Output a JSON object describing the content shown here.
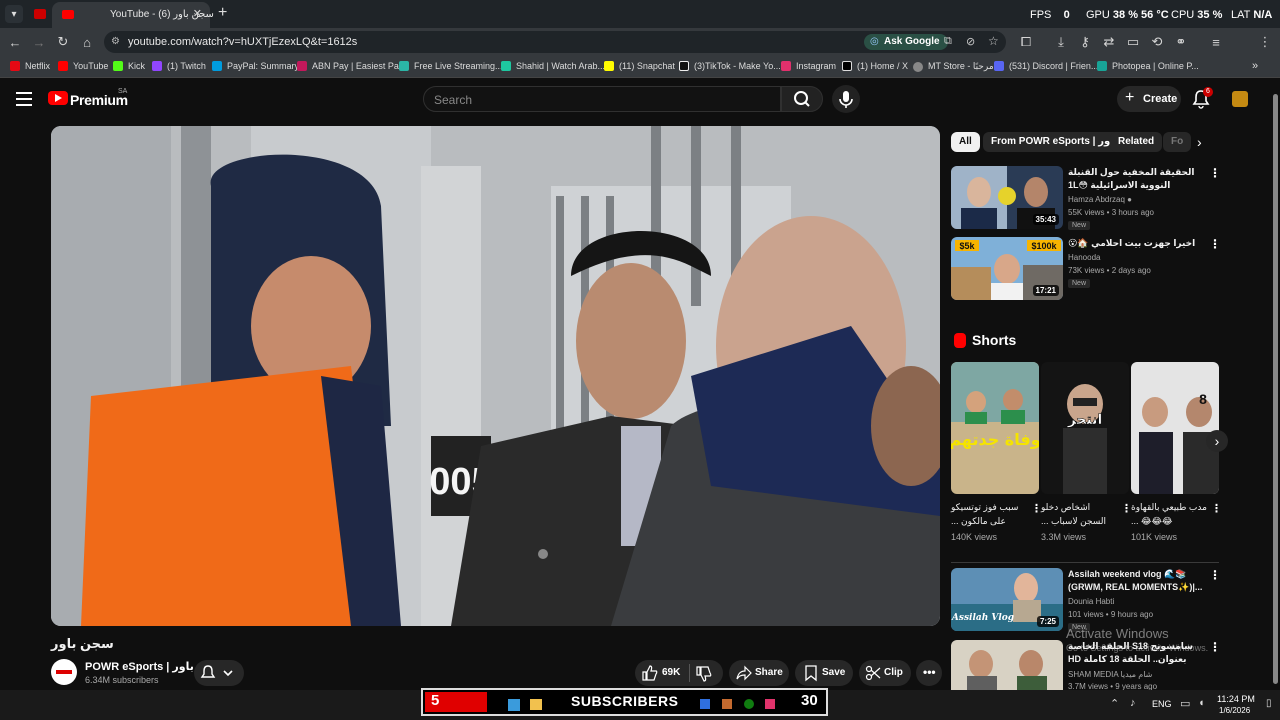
{
  "browser": {
    "active_tab_title": "YouTube - سجن باور (6)",
    "url": "youtube.com/watch?v=hUXTjEzexLQ&t=1612s",
    "ask_google_label": "Ask Google",
    "bookmarks": [
      {
        "label": "Netflix",
        "color": "#e50914"
      },
      {
        "label": "YouTube",
        "color": "#ff0000"
      },
      {
        "label": "Kick",
        "color": "#53fc18"
      },
      {
        "label": "(1) Twitch",
        "color": "#9146ff"
      },
      {
        "label": "PayPal: Summary",
        "color": "#009cde"
      },
      {
        "label": "ABN Pay | Easiest Pa...",
        "color": "#c2185b"
      },
      {
        "label": "Free Live Streaming...",
        "color": "#2bb5a6"
      },
      {
        "label": "Shahid | Watch Arab...",
        "color": "#1ec8a0"
      },
      {
        "label": "(11) Snapchat",
        "color": "#fffc00"
      },
      {
        "label": "(3)TikTok - Make Yo...",
        "color": "#eeeeee"
      },
      {
        "label": "Instagram",
        "color": "#e1306c"
      },
      {
        "label": "(1) Home / X",
        "color": "#dddddd"
      },
      {
        "label": "MT Store - مرحبًا",
        "color": "#888888"
      },
      {
        "label": "(531) Discord | Frien...",
        "color": "#5865f2"
      },
      {
        "label": "Photopea | Online P...",
        "color": "#18a497"
      }
    ]
  },
  "overlay": {
    "fps_label": "FPS",
    "fps_value": "0",
    "gpu_label": "GPU",
    "gpu_value": "38 % 56 °C",
    "cpu_label": "CPU",
    "cpu_value": "35 %",
    "lat_label": "LAT",
    "lat_value": "N/A"
  },
  "youtube": {
    "brand": "Premium",
    "country_code": "SA",
    "search_placeholder": "Search",
    "create_label": "Create",
    "notification_count": "6",
    "video": {
      "title": "سجن باور",
      "channel": "POWR eSports | باور",
      "subscribers": "6.34M subscribers",
      "cell_number": "005",
      "likes": "69K",
      "share_label": "Share",
      "save_label": "Save",
      "clip_label": "Clip"
    },
    "chips": [
      "All",
      "From POWR eSports | باور",
      "Related",
      "Fo"
    ],
    "recommendations": [
      {
        "title": "الحقيقة المخفية حول القنبلة النووية الاسرائيلية 😳1L",
        "channel": "Hamza Abdrzaq",
        "meta": "55K views • 3 hours ago",
        "badge": "New",
        "duration": "35:43"
      },
      {
        "title": "اخيرا جهزت بيت احلامي 🏠😮",
        "channel": "Hanooda",
        "meta": "73K views • 2 days ago",
        "badge": "New",
        "duration": "17:21",
        "thumb_tags": [
          "$5k",
          "$100k"
        ]
      },
      {
        "title": "Assilah weekend vlog 🌊📚 (GRWM, REAL MOMENTS✨)|...",
        "channel": "Dounia Habti",
        "meta": "101 views • 9 hours ago",
        "badge": "New",
        "duration": "7:25",
        "thumb_text": "Assilah Vlog"
      },
      {
        "title": "سامسونج S18 الحلقة الخاصة بعنوان.. الحلقة 18 كاملة HD",
        "channel": "SHAM MEDIA شام ميديا",
        "meta": "3.7M views • 9 years ago",
        "badge": "",
        "duration": ""
      }
    ],
    "shorts_heading": "Shorts",
    "shorts": [
      {
        "title": "سبب فوز توتسيكو على مالكون ...",
        "views": "140K views",
        "thumb_text": "وفاة جدتهم"
      },
      {
        "title": "اشخاص دخلو السجن لاسباب ...",
        "views": "3.3M views",
        "thumb_text": "انتحر"
      },
      {
        "title": "مدب طبيعي بالقهاوة 😂😂😂 ...",
        "views": "101K views",
        "thumb_text": "8"
      }
    ]
  },
  "watermark": {
    "line1": "Activate Windows",
    "line2": "Go to Settings to activate Windows."
  },
  "taskbar": {
    "left_number": "5",
    "banner_text": "SUBSCRIBERS",
    "right_number": "30",
    "language": "ENG",
    "time": "11:24 PM",
    "date": "1/6/2026"
  }
}
